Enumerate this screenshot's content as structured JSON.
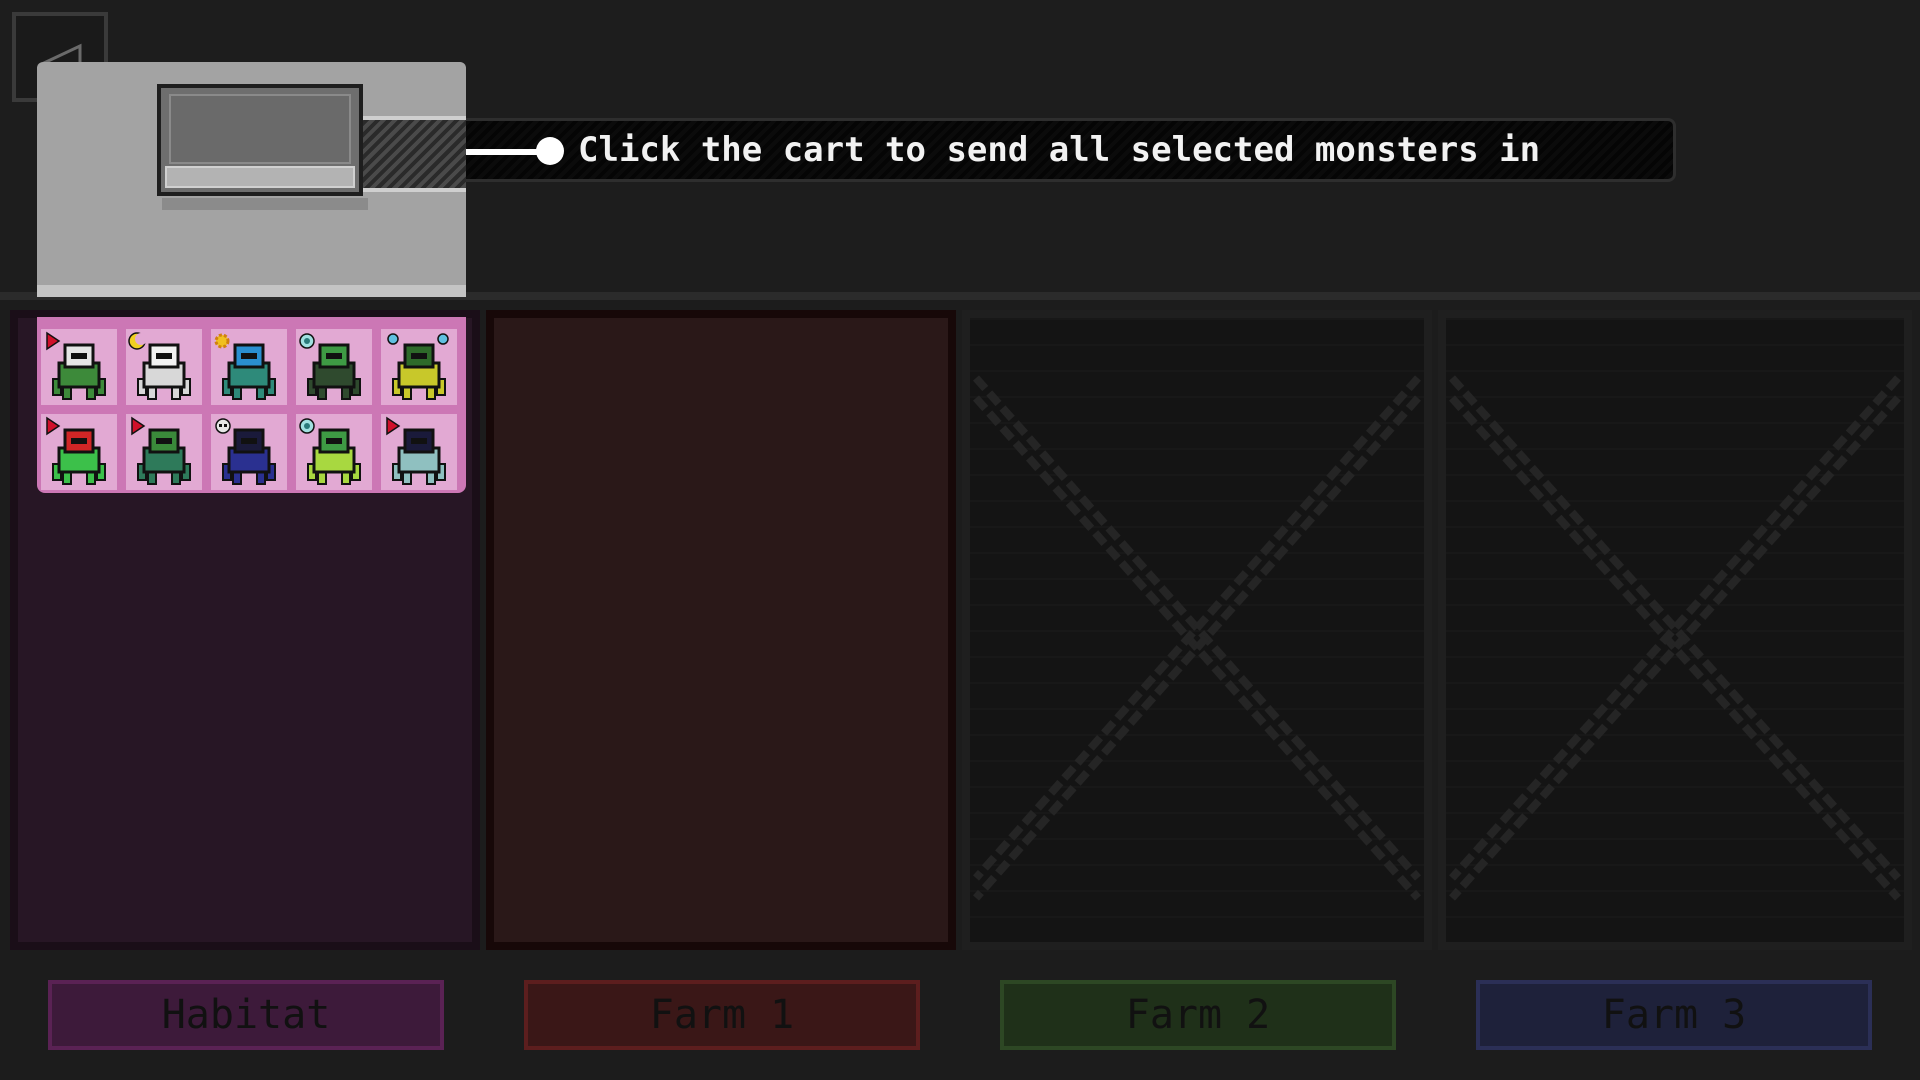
{
  "tutorial": {
    "hint": "Click the cart to send all selected monsters in"
  },
  "pens": [
    {
      "label": "Habitat",
      "color": "#3d1a3a",
      "locked": false
    },
    {
      "label": "Farm 1",
      "color": "#3a1717",
      "locked": false
    },
    {
      "label": "Farm 2",
      "color": "#1f3019",
      "locked": true
    },
    {
      "label": "Farm 3",
      "color": "#1e213a",
      "locked": true
    }
  ],
  "selected_monsters": [
    {
      "body": "#3d8a3a",
      "head": "#e6e6e6",
      "badge": "red-flag-icon"
    },
    {
      "body": "#d8d8d8",
      "head": "#f2f2f2",
      "badge": "crescent-moon-icon"
    },
    {
      "body": "#2e8a7a",
      "head": "#2a8fd0",
      "badge": "sun-icon"
    },
    {
      "body": "#2f4a2e",
      "head": "#3e9a44",
      "badge": "target-icon"
    },
    {
      "body": "#c8c82a",
      "head": "#2e6a2a",
      "badge": "bubbles-icon"
    },
    {
      "body": "#3cc04a",
      "head": "#d02626",
      "badge": "red-flag-icon"
    },
    {
      "body": "#2e7a5a",
      "head": "#3a8a3a",
      "badge": "red-flag-icon"
    },
    {
      "body": "#2a3090",
      "head": "#1a1a3a",
      "badge": "skull-icon"
    },
    {
      "body": "#a8d840",
      "head": "#3e9a44",
      "badge": "target-icon"
    },
    {
      "body": "#8fc0c0",
      "head": "#1a1a3a",
      "badge": "red-flag-icon"
    }
  ],
  "accents": {
    "selection": "#cc77b5",
    "slot": "#e2a9d3"
  }
}
